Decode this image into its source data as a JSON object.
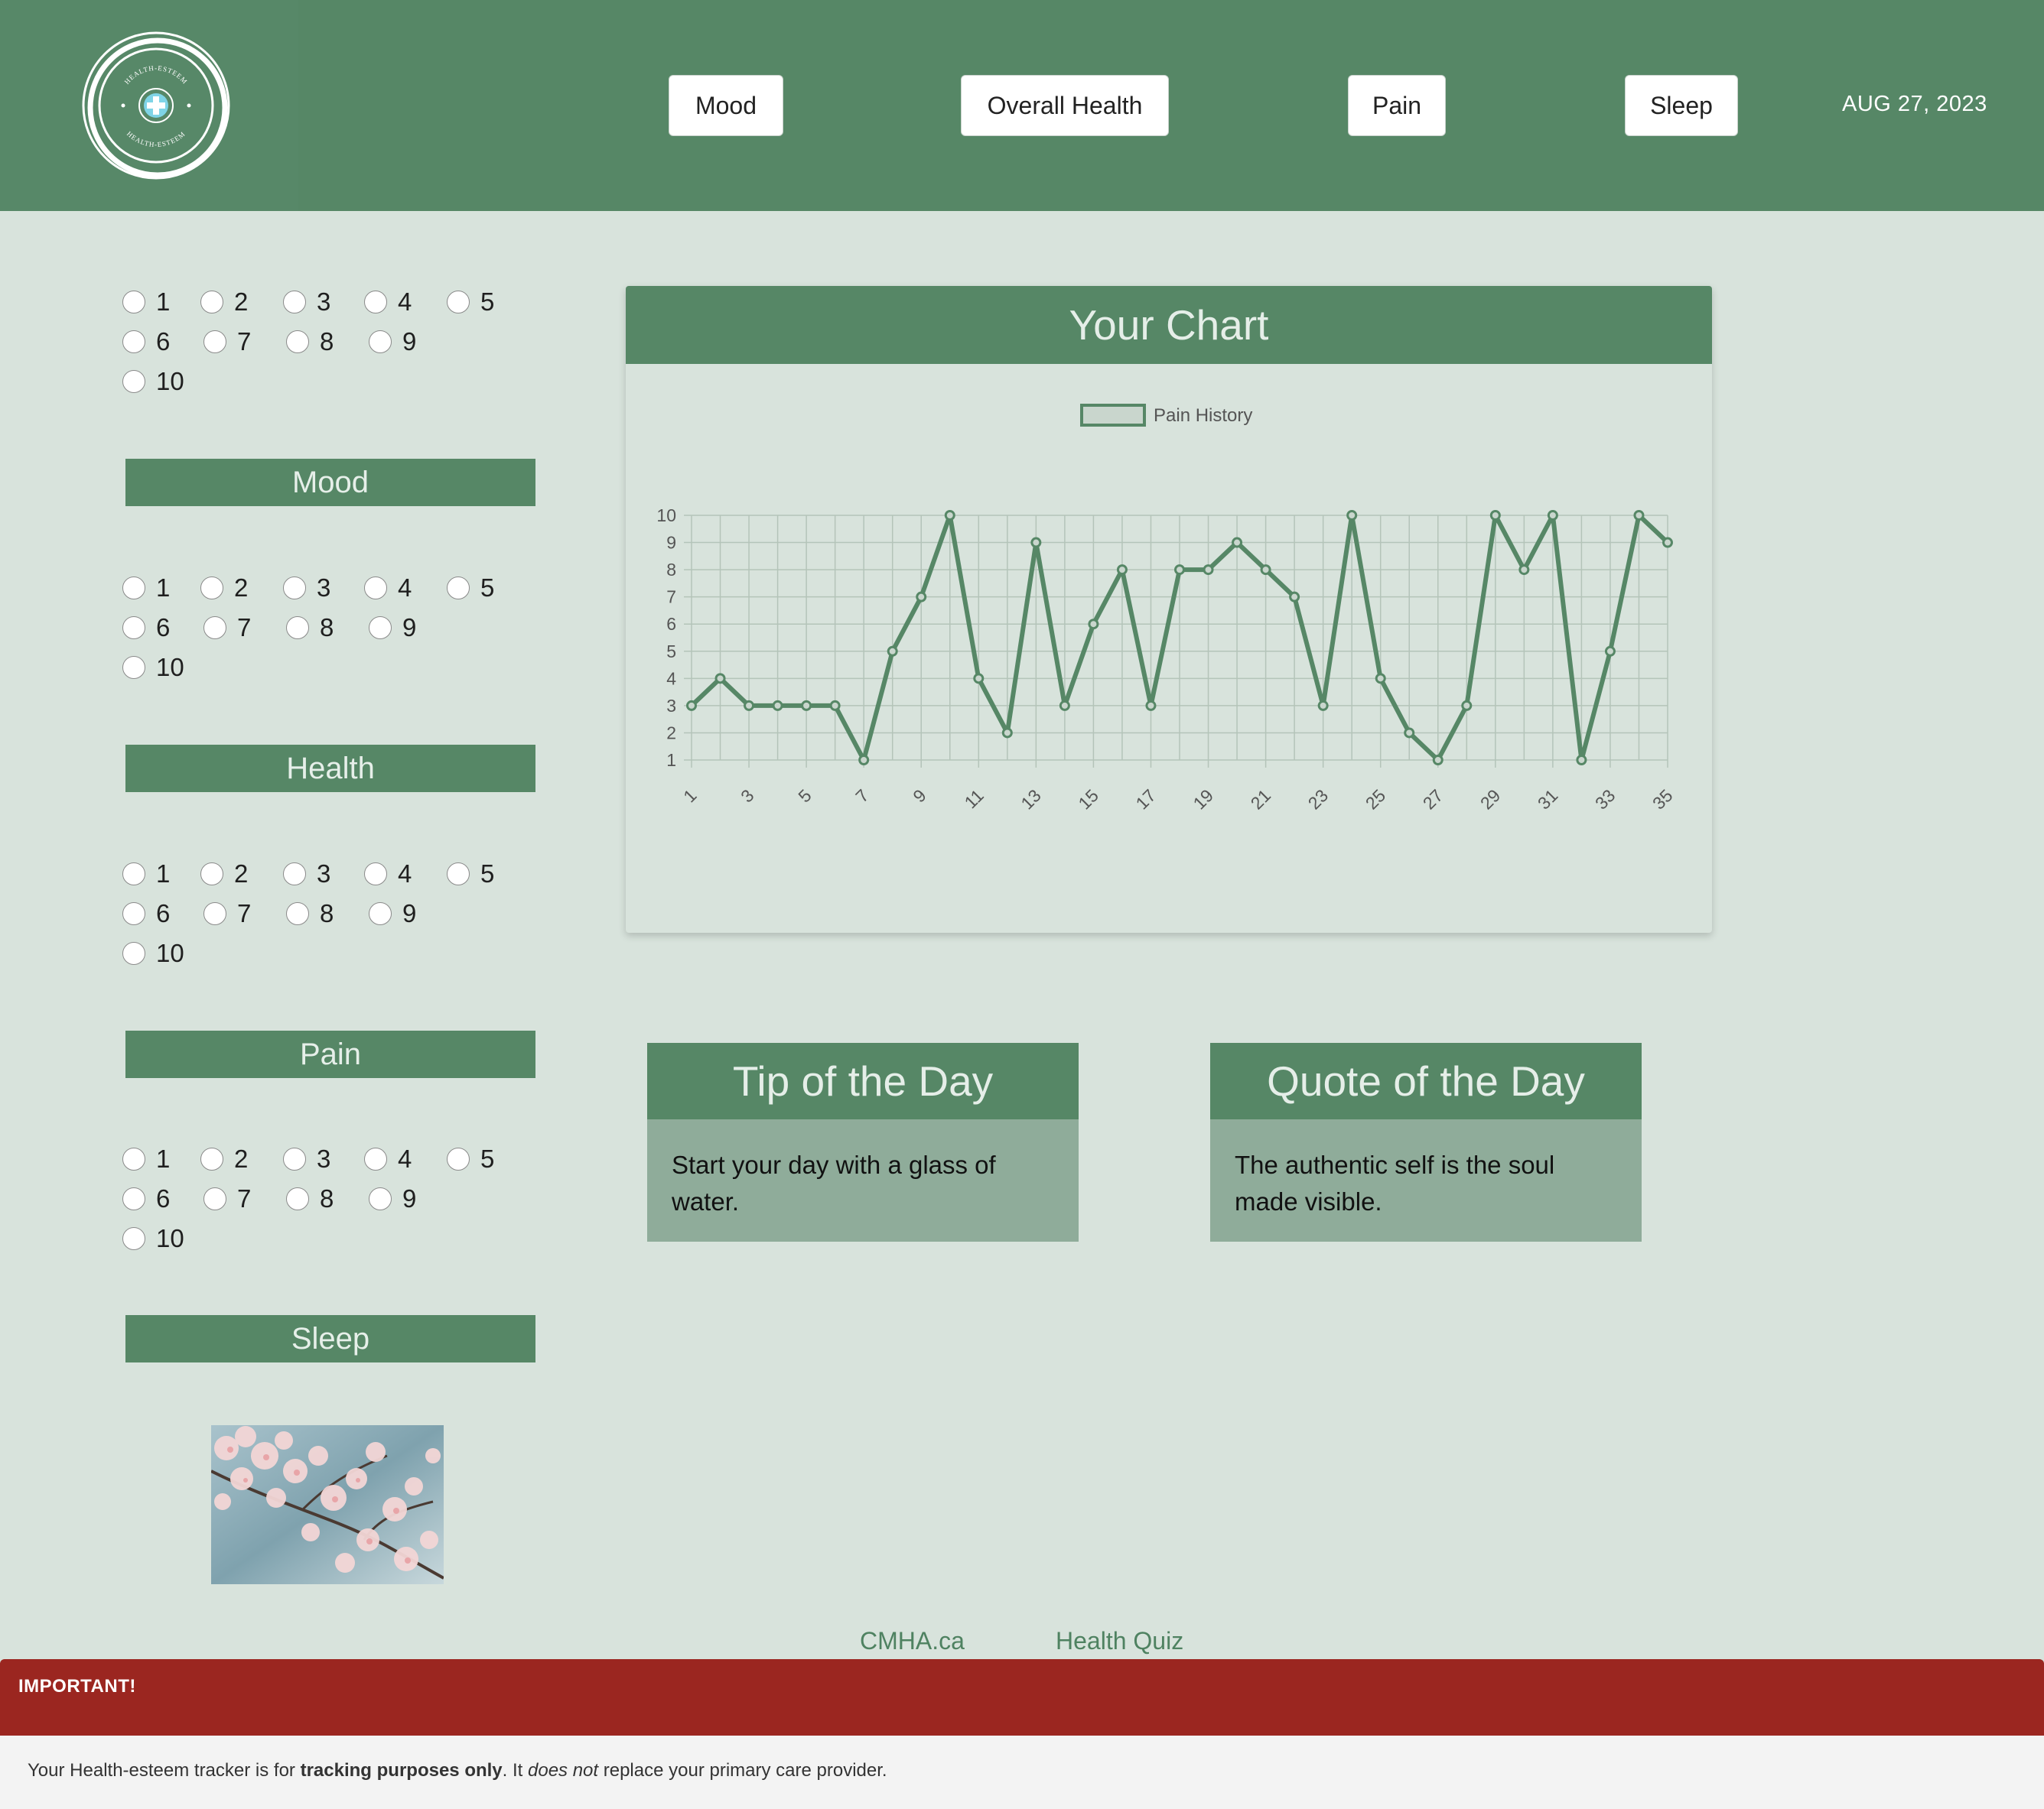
{
  "header": {
    "logo_text": "HEALTH-ESTEEM",
    "nav": [
      "Mood",
      "Overall Health",
      "Pain",
      "Sleep"
    ],
    "date": "AUG 27, 2023"
  },
  "rating_options": [
    "1",
    "2",
    "3",
    "4",
    "5",
    "6",
    "7",
    "8",
    "9",
    "10"
  ],
  "sections": [
    "Mood",
    "Health",
    "Pain",
    "Sleep"
  ],
  "chart": {
    "title": "Your Chart"
  },
  "chart_data": {
    "type": "line",
    "legend": "Pain History",
    "legend_position": "top-center",
    "x": [
      1,
      2,
      3,
      4,
      5,
      6,
      7,
      8,
      9,
      10,
      11,
      12,
      13,
      14,
      15,
      16,
      17,
      18,
      19,
      20,
      21,
      22,
      23,
      24,
      25,
      26,
      27,
      28,
      29,
      30,
      31,
      32,
      33,
      34,
      35
    ],
    "x_tick_labels": [
      "1",
      "3",
      "5",
      "7",
      "9",
      "11",
      "13",
      "15",
      "17",
      "19",
      "21",
      "23",
      "25",
      "27",
      "29",
      "31",
      "33",
      "35"
    ],
    "series": [
      {
        "name": "Pain History",
        "values": [
          3,
          4,
          3,
          3,
          3,
          3,
          1,
          5,
          7,
          10,
          4,
          2,
          9,
          3,
          6,
          8,
          3,
          8,
          8,
          9,
          8,
          7,
          3,
          10,
          4,
          2,
          1,
          3,
          10,
          8,
          10,
          1,
          5,
          10,
          9
        ]
      }
    ],
    "ylim": [
      1,
      10
    ],
    "y_tick_labels": [
      "1",
      "2",
      "3",
      "4",
      "5",
      "6",
      "7",
      "8",
      "9",
      "10"
    ],
    "grid": true,
    "line_color": "#568766"
  },
  "tip": {
    "title": "Tip of the Day",
    "text": "Start your day with a glass of water."
  },
  "quote": {
    "title": "Quote of the Day",
    "text": "The authentic self is the soul made visible."
  },
  "links": [
    "CMHA.ca",
    "Health Quiz"
  ],
  "banner": {
    "label": "IMPORTANT!"
  },
  "footer": {
    "part1": "Your Health-esteem tracker is for ",
    "bold": "tracking purposes only",
    "part2": ". It ",
    "italic": "does not",
    "part3": " replace your primary care provider."
  }
}
